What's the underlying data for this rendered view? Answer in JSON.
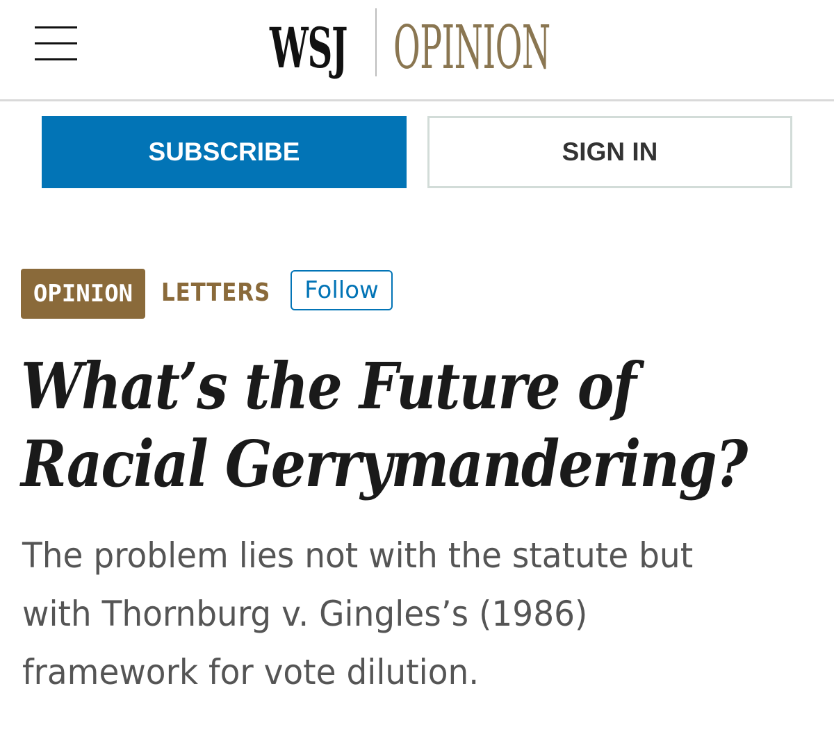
{
  "header": {
    "menu_icon": "hamburger-menu-icon",
    "logo_wsj": "WSJ",
    "logo_section": "OPINION"
  },
  "auth": {
    "subscribe_label": "SUBSCRIBE",
    "signin_label": "SIGN IN"
  },
  "article": {
    "section_tag": "OPINION",
    "subsection": "LETTERS",
    "follow_label": "Follow",
    "headline_lines": [
      "What’s the Future of",
      "Racial Gerrymandering?"
    ],
    "dek_lines": [
      "The problem lies not with the statute but",
      "with Thornburg v. Gingles’s (1986)",
      "framework for vote dilution."
    ]
  },
  "colors": {
    "accent_blue": "#0274b6",
    "opinion_gold": "#8a6a3a",
    "masthead_gold": "#8a7651"
  }
}
